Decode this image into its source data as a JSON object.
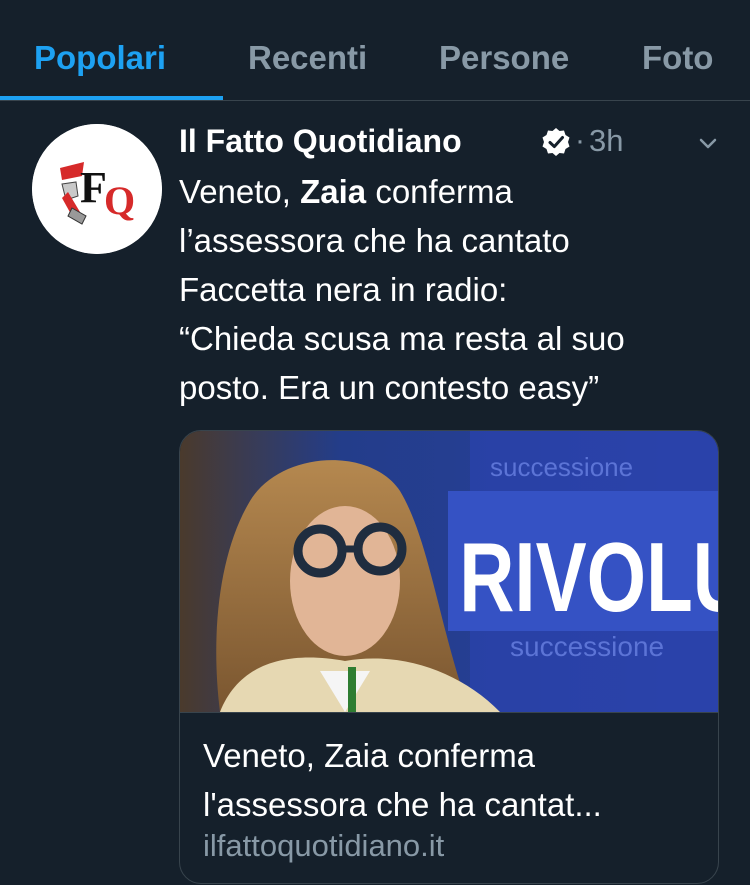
{
  "tabs": [
    {
      "label": "Popolari",
      "active": true
    },
    {
      "label": "Recenti",
      "active": false
    },
    {
      "label": "Persone",
      "active": false
    },
    {
      "label": "Foto",
      "active": false
    }
  ],
  "tweet": {
    "avatar_icon": "il-fatto-quotidiano-logo",
    "author": "Il Fatto Quotidiano",
    "verified_icon": "verified-badge-icon",
    "separator": "·",
    "time": "3h",
    "menu_icon": "chevron-down-icon",
    "text_lines": [
      {
        "before": "Veneto, ",
        "bold": "Zaia",
        "after": " conferma"
      },
      {
        "before": "l’assessora che ha cantato",
        "bold": "",
        "after": ""
      },
      {
        "before": "Faccetta nera in radio:",
        "bold": "",
        "after": ""
      },
      {
        "before": "“Chieda scusa ma resta al suo",
        "bold": "",
        "after": ""
      },
      {
        "before": "posto. Era un contesto easy”",
        "bold": "",
        "after": ""
      }
    ]
  },
  "card": {
    "image_sign_text": "RIVOLU",
    "image_text_1": "successione",
    "image_text_2": "successione",
    "title_lines": [
      "Veneto, Zaia conferma",
      "l'assessora che ha cantat..."
    ],
    "domain": "ilfattoquotidiano.it"
  },
  "colors": {
    "background": "#15202b",
    "accent": "#1da1f2",
    "secondary_text": "#8899a6",
    "border": "#38444d"
  }
}
